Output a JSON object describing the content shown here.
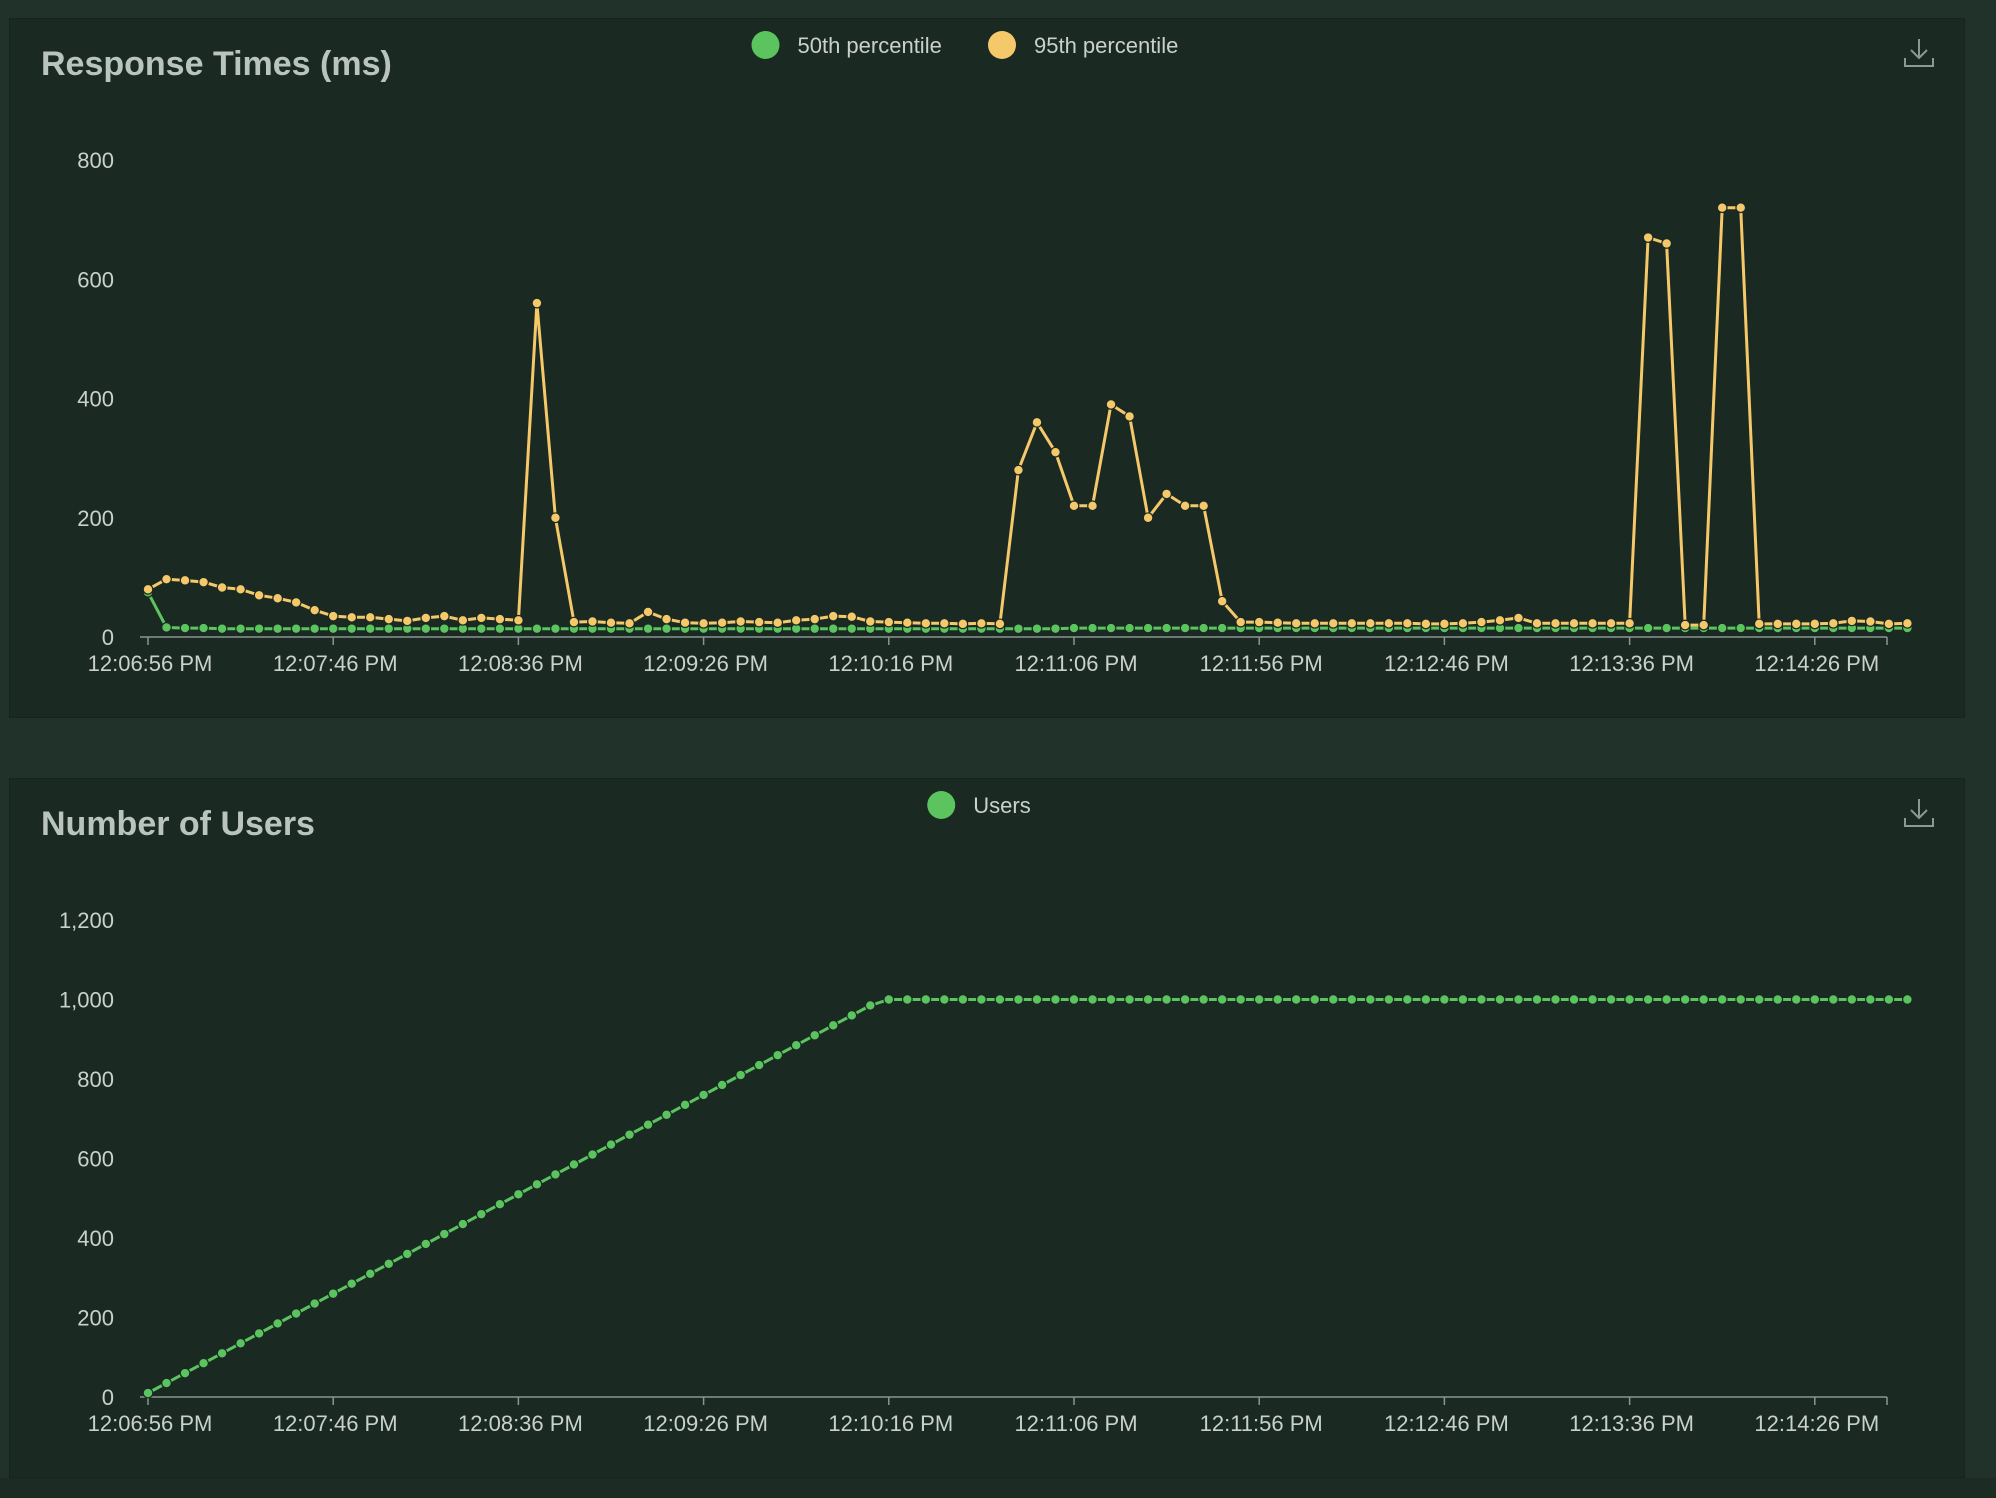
{
  "charts": {
    "response_times": {
      "title": "Response Times (ms)",
      "download_label": "download-icon"
    },
    "users": {
      "title": "Number of Users",
      "download_label": "download-icon"
    }
  },
  "colors": {
    "p50": "#5bc45f",
    "p95": "#f5c96a",
    "users": "#5bc45f",
    "axis_text": "#c9d1cc",
    "axis_line": "#8a968f"
  },
  "chart_data": [
    {
      "type": "line",
      "title": "Response Times (ms)",
      "xlabel": "",
      "ylabel": "",
      "ylim": [
        0,
        800
      ],
      "yticks": [
        "0",
        "200",
        "400",
        "600",
        "800"
      ],
      "ytick_values": [
        0,
        200,
        400,
        600,
        800
      ],
      "xticks": [
        "12:06:56 PM",
        "12:07:46 PM",
        "12:08:36 PM",
        "12:09:26 PM",
        "12:10:16 PM",
        "12:11:06 PM",
        "12:11:56 PM",
        "12:12:46 PM",
        "12:13:36 PM",
        "12:14:26 PM"
      ],
      "legend_position": "top-center",
      "grid": false,
      "x_interval_seconds": 5,
      "series": [
        {
          "name": "50th percentile",
          "color": "#5bc45f",
          "values": [
            75,
            16,
            15,
            15,
            14,
            14,
            14,
            14,
            14,
            14,
            14,
            14,
            14,
            14,
            14,
            14,
            14,
            14,
            14,
            14,
            14,
            14,
            14,
            14,
            14,
            14,
            14,
            14,
            14,
            14,
            14,
            14,
            14,
            14,
            14,
            14,
            14,
            14,
            14,
            14,
            14,
            14,
            14,
            14,
            14,
            14,
            14,
            14,
            14,
            14,
            15,
            15,
            15,
            15,
            15,
            15,
            15,
            15,
            15,
            15,
            15,
            15,
            15,
            15,
            15,
            15,
            15,
            15,
            15,
            15,
            15,
            15,
            15,
            15,
            15,
            15,
            15,
            15,
            15,
            15,
            15,
            15,
            15,
            15,
            15,
            15,
            15,
            15,
            15,
            15,
            15,
            15,
            15,
            15,
            15,
            15
          ]
        },
        {
          "name": "95th percentile",
          "color": "#f5c96a",
          "values": [
            80,
            97,
            95,
            92,
            83,
            80,
            70,
            65,
            58,
            45,
            35,
            33,
            33,
            30,
            27,
            32,
            35,
            28,
            32,
            30,
            28,
            560,
            200,
            25,
            26,
            24,
            23,
            42,
            30,
            24,
            23,
            24,
            26,
            25,
            24,
            28,
            30,
            35,
            34,
            26,
            25,
            24,
            23,
            23,
            22,
            23,
            22,
            280,
            360,
            310,
            220,
            220,
            390,
            370,
            200,
            240,
            220,
            220,
            60,
            25,
            25,
            24,
            23,
            23,
            23,
            23,
            23,
            23,
            23,
            22,
            22,
            23,
            25,
            28,
            32,
            23,
            23,
            23,
            23,
            23,
            23,
            670,
            660,
            20,
            20,
            720,
            720,
            22,
            22,
            22,
            22,
            23,
            27,
            26,
            22,
            23
          ]
        }
      ]
    },
    {
      "type": "line",
      "title": "Number of Users",
      "xlabel": "",
      "ylabel": "",
      "ylim": [
        0,
        1200
      ],
      "yticks": [
        "0",
        "200",
        "400",
        "600",
        "800",
        "1,000",
        "1,200"
      ],
      "ytick_values": [
        0,
        200,
        400,
        600,
        800,
        1000,
        1200
      ],
      "xticks": [
        "12:06:56 PM",
        "12:07:46 PM",
        "12:08:36 PM",
        "12:09:26 PM",
        "12:10:16 PM",
        "12:11:06 PM",
        "12:11:56 PM",
        "12:12:46 PM",
        "12:13:36 PM",
        "12:14:26 PM"
      ],
      "legend_position": "top-center",
      "grid": false,
      "x_interval_seconds": 5,
      "series": [
        {
          "name": "Users",
          "color": "#5bc45f",
          "values": [
            10,
            35,
            60,
            85,
            110,
            135,
            160,
            185,
            210,
            235,
            260,
            285,
            310,
            335,
            360,
            385,
            410,
            435,
            460,
            485,
            510,
            535,
            560,
            585,
            610,
            635,
            660,
            685,
            710,
            735,
            760,
            785,
            810,
            835,
            860,
            885,
            910,
            935,
            960,
            985,
            1000,
            1000,
            1000,
            1000,
            1000,
            1000,
            1000,
            1000,
            1000,
            1000,
            1000,
            1000,
            1000,
            1000,
            1000,
            1000,
            1000,
            1000,
            1000,
            1000,
            1000,
            1000,
            1000,
            1000,
            1000,
            1000,
            1000,
            1000,
            1000,
            1000,
            1000,
            1000,
            1000,
            1000,
            1000,
            1000,
            1000,
            1000,
            1000,
            1000,
            1000,
            1000,
            1000,
            1000,
            1000,
            1000,
            1000,
            1000,
            1000,
            1000,
            1000,
            1000,
            1000,
            1000,
            1000,
            1000
          ]
        }
      ]
    }
  ]
}
